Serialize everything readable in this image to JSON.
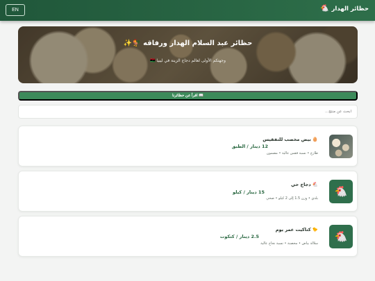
{
  "header": {
    "brand": "حظائر الهدار",
    "brand_icon": "chicken-icon",
    "lang_button": "EN"
  },
  "hero": {
    "title": "حظائر عبد السلام الهدار ورفاقه 🐓✨",
    "subtitle": "وجهتكم الأولى لعالم دجاج الزينة في ليبيا 🇱🇾"
  },
  "about_button": {
    "icon": "book-icon",
    "label": "📖 اقرأ عن حظائرنا"
  },
  "search": {
    "placeholder": "ابحث عن منتج...",
    "value": ""
  },
  "products": [
    {
      "icon": "egg-icon",
      "name": "🥚 بيض مخصب للتفقيس",
      "price": "12 دينار / الطبق",
      "desc": "طازج • نسبة فقس عالية • مضمون",
      "thumb": "photo"
    },
    {
      "icon": "chicken-icon",
      "name": "🐔 دجاج حي",
      "price": "15 دينار / كيلو",
      "desc": "بلدي • وزن 1.5 إلى 2 كيلو • صحي",
      "thumb": "chicken"
    },
    {
      "icon": "chick-icon",
      "name": "🐤 كتاكيت عمر يوم",
      "price": "2.5 دينار / كتكوت",
      "desc": "سلالة بياض • محصنة • نسبة نجاح عالية",
      "thumb": "chicken"
    }
  ],
  "colors": {
    "header": "#2e6f4a",
    "accent": "#3c8a5a",
    "price": "#27663f"
  }
}
